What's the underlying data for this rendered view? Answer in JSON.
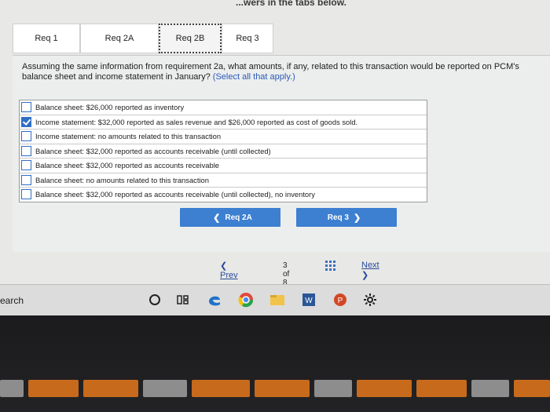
{
  "header": {
    "instruction_fragment": "...wers in the tabs below."
  },
  "tabs": [
    {
      "label": "Req 1",
      "active": false
    },
    {
      "label": "Req 2A",
      "active": false
    },
    {
      "label": "Req 2B",
      "active": true
    },
    {
      "label": "Req 3",
      "active": false
    }
  ],
  "question": {
    "text": "Assuming the same information from requirement 2a, what amounts, if any, related to this transaction would be reported on PCM's balance sheet and income statement in January?",
    "hint": "(Select all that apply.)"
  },
  "options": [
    {
      "label": "Balance sheet: $26,000 reported as inventory",
      "checked": false
    },
    {
      "label": "Income statement: $32,000 reported as sales revenue and $26,000 reported as cost of goods sold.",
      "checked": true
    },
    {
      "label": "Income statement: no amounts related to this transaction",
      "checked": false
    },
    {
      "label": "Balance sheet: $32,000 reported as accounts receivable (until collected)",
      "checked": false
    },
    {
      "label": "Balance sheet: $32,000 reported as accounts receivable",
      "checked": false
    },
    {
      "label": "Balance sheet: no amounts related to this transaction",
      "checked": false
    },
    {
      "label": "Balance sheet: $32,000 reported as accounts receivable (until collected), no inventory",
      "checked": false
    }
  ],
  "nav": {
    "prev_label": "Req 2A",
    "next_label": "Req 3"
  },
  "pager": {
    "prev_label": "Prev",
    "count_label": "3 of 8",
    "next_label": "Next"
  },
  "taskbar": {
    "search_label": "earch"
  },
  "colors": {
    "accent": "#3d7fd1",
    "checkbox": "#2f6fc4",
    "hint": "#2a5ab8"
  }
}
